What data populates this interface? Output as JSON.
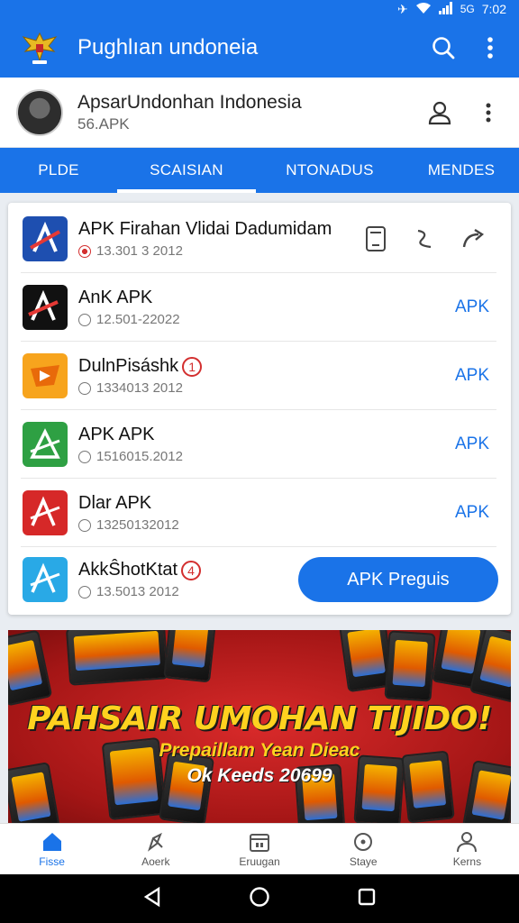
{
  "status_bar": {
    "network": "5G",
    "time": "7:02"
  },
  "app_bar": {
    "title": "Pughlıan undoneia"
  },
  "profile": {
    "name": "ApsarUndonhan Indonesia",
    "subtitle": "56.APK"
  },
  "tabs": [
    {
      "label": "PLDE"
    },
    {
      "label": "SCAISIAN"
    },
    {
      "label": "NTONADUS"
    },
    {
      "label": "MENDES"
    }
  ],
  "apps": [
    {
      "name": "APK Firahan Vlidai Dadumidam",
      "meta": "13.301 3 2012"
    },
    {
      "name": "AnK APK",
      "meta": "12.501-22022",
      "action": "APK"
    },
    {
      "name": "DulnPisáshk",
      "badge": "1",
      "meta": "1334013 2012",
      "action": "APK"
    },
    {
      "name": "APK APK",
      "meta": "1516015.2012",
      "action": "APK"
    },
    {
      "name": "Dlar APK",
      "meta": "13250132012",
      "action": "APK"
    },
    {
      "name": "AkkŜhotKtat",
      "badge": "4",
      "meta": "13.5013 2012",
      "action": "APK Preguis"
    }
  ],
  "banner": {
    "headline": "PAHSAIR UMOHAN TIJIDO!",
    "line1": "Prepaillam Yean Dieac",
    "line2": "Ok Keeds 20699"
  },
  "bottom_nav": [
    {
      "label": "Fisse"
    },
    {
      "label": "Aoerk"
    },
    {
      "label": "Eruugan"
    },
    {
      "label": "Staye"
    },
    {
      "label": "Kerns"
    }
  ],
  "colors": {
    "primary": "#1a73e8",
    "banner_red": "#c41e1e",
    "banner_yellow": "#ffd21f"
  }
}
